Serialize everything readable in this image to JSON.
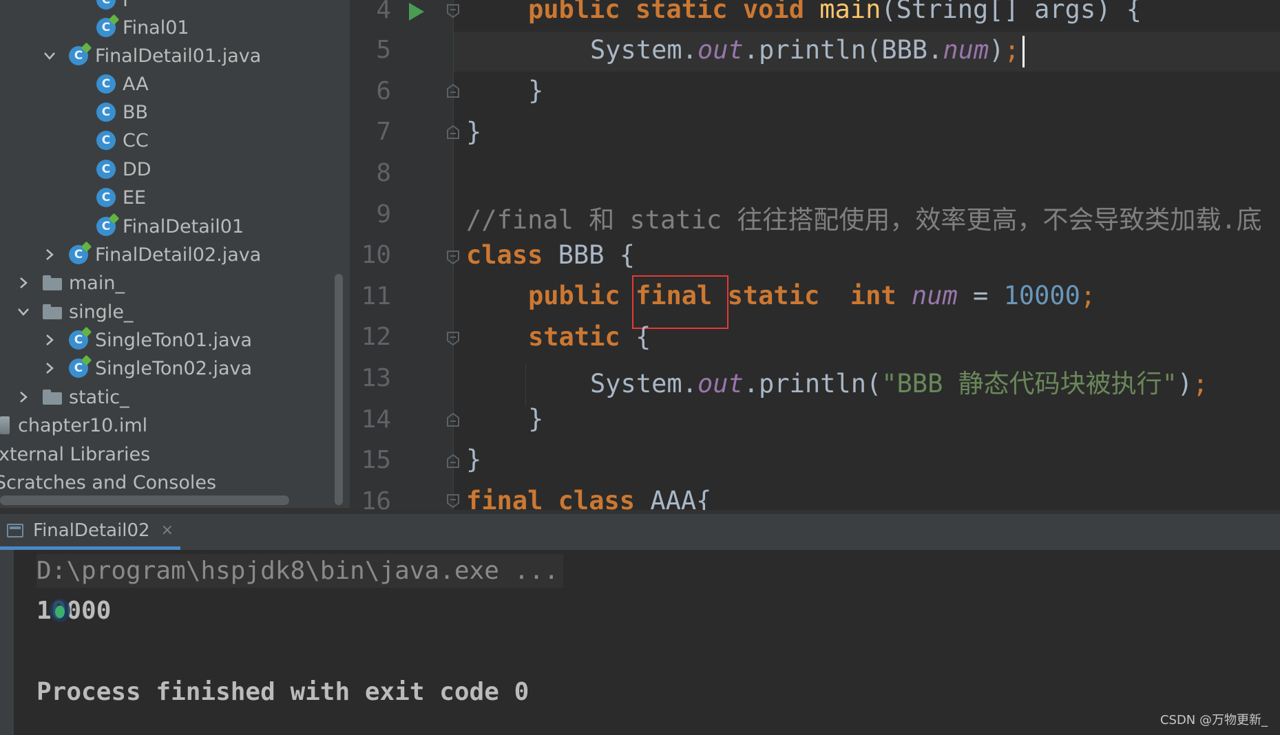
{
  "project_tree": {
    "items": [
      {
        "label": "F",
        "type": "class-java"
      },
      {
        "label": "Final01",
        "type": "class-java"
      },
      {
        "label": "FinalDetail01.java",
        "type": "file-java",
        "expanded": true
      },
      {
        "label": "AA",
        "type": "class"
      },
      {
        "label": "BB",
        "type": "class"
      },
      {
        "label": "CC",
        "type": "class"
      },
      {
        "label": "DD",
        "type": "class"
      },
      {
        "label": "EE",
        "type": "class"
      },
      {
        "label": "FinalDetail01",
        "type": "class-java"
      },
      {
        "label": "FinalDetail02.java",
        "type": "file-java",
        "expanded": false
      },
      {
        "label": "main_",
        "type": "folder",
        "expanded": false
      },
      {
        "label": "single_",
        "type": "folder",
        "expanded": true
      },
      {
        "label": "SingleTon01.java",
        "type": "file-java",
        "expanded": false
      },
      {
        "label": "SingleTon02.java",
        "type": "file-java",
        "expanded": false
      },
      {
        "label": "static_",
        "type": "folder",
        "expanded": false
      },
      {
        "label": "chapter10.iml",
        "type": "iml"
      },
      {
        "label": "xternal Libraries",
        "type": "text"
      },
      {
        "label": "Scratches and Consoles",
        "type": "text"
      }
    ]
  },
  "editor": {
    "line_numbers": [
      "4",
      "5",
      "6",
      "7",
      "8",
      "9",
      "10",
      "11",
      "12",
      "13",
      "14",
      "15",
      "16"
    ],
    "code": {
      "l4_kw": "public static void ",
      "l4_fn": "main",
      "l4_rest": "(String[] args) {",
      "l5_a": "System.",
      "l5_out": "out",
      "l5_b": ".println(BBB.",
      "l5_num": "num",
      "l5_c": ")",
      "l5_semi": ";",
      "l6": "}",
      "l7": "}",
      "l9_comment": "//final 和 static 往往搭配使用，效率更高，不会导致类加载.底",
      "l10_kw": "class ",
      "l10_rest": "BBB {",
      "l11_kw1": "public ",
      "l11_kw2": "final",
      "l11_kw3": " static  int ",
      "l11_var": "num",
      "l11_eq": " = ",
      "l11_val": "10000",
      "l11_semi": ";",
      "l12_kw": "static ",
      "l12_rest": "{",
      "l13_a": "System.",
      "l13_out": "out",
      "l13_b": ".println(",
      "l13_str": "\"BBB 静态代码块被执行\"",
      "l13_c": ")",
      "l13_semi": ";",
      "l14": "}",
      "l15": "}",
      "l16_kw": "final class ",
      "l16_rest": "AAA{"
    }
  },
  "run_panel": {
    "tab_label": "FinalDetail02",
    "tab_close": "×",
    "command": "D:\\program\\hspjdk8\\bin\\java.exe ...",
    "output": "10000",
    "process": "Process finished with exit code 0"
  },
  "watermark": "CSDN @万物更新_",
  "colors": {
    "keyword": "#cc7832",
    "method": "#ffc66d",
    "field": "#9876aa",
    "number": "#6897bb",
    "string": "#6a8759",
    "comment": "#808080",
    "highlight_box": "#e53935",
    "class_icon": "#3a8fcf"
  }
}
